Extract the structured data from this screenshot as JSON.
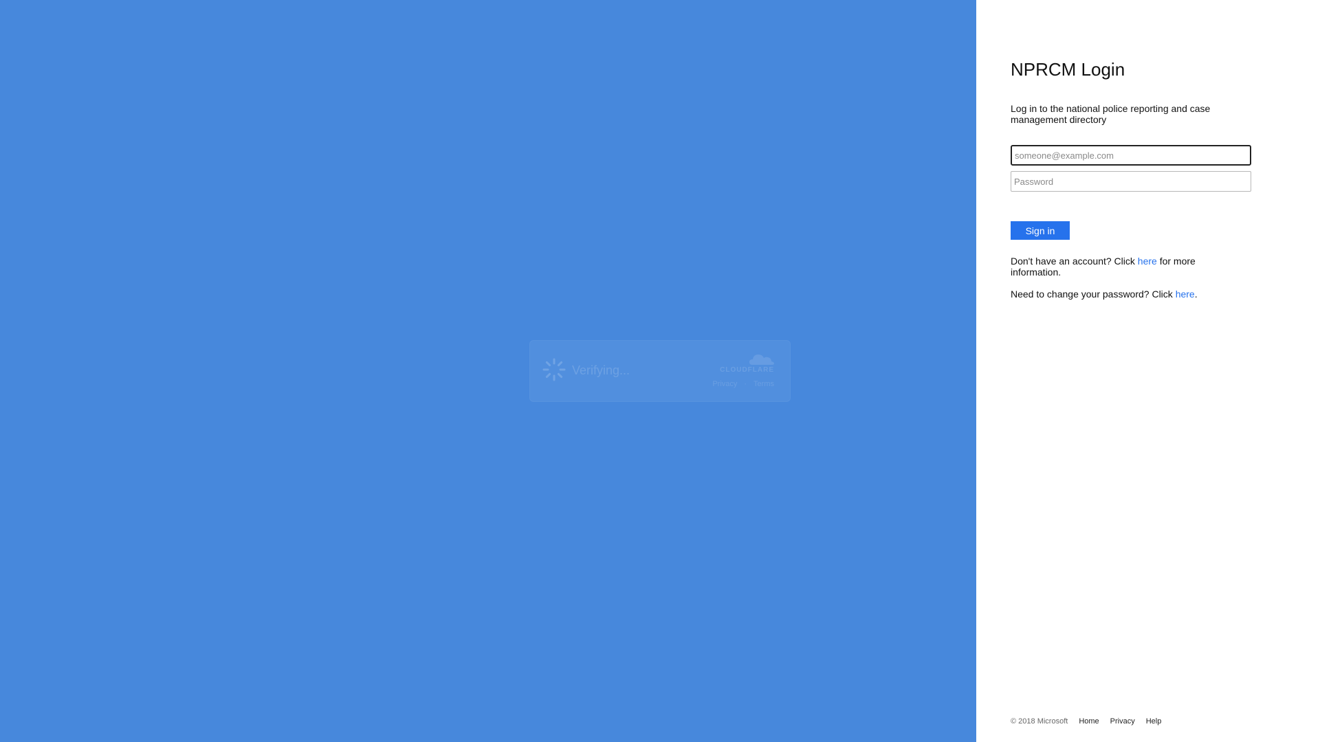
{
  "cloudflare_widget": {
    "status": "Verifying...",
    "brand": "CLOUDFLARE",
    "links": [
      "Privacy",
      "Terms"
    ]
  },
  "login": {
    "title": "NPRCM Login",
    "description": "Log in to the national police reporting and case management directory",
    "email_placeholder": "someone@example.com",
    "password_placeholder": "Password",
    "signin_label": "Sign in",
    "account_prefix": "Don't have an account? Click ",
    "account_link": "here",
    "account_suffix": " for more information.",
    "password_prefix": "Need to change your password? Click ",
    "password_link": "here",
    "password_suffix": "."
  },
  "footer": {
    "copyright": "© 2018 Microsoft",
    "links": [
      "Home",
      "Privacy",
      "Help"
    ]
  },
  "colors": {
    "background_blue": "#4788dc",
    "accent": "#2672ec",
    "panel": "#ffffff"
  }
}
